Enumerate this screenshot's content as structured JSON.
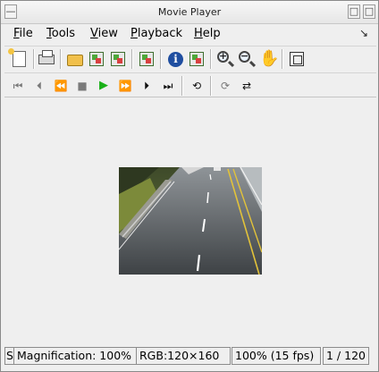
{
  "window": {
    "title": "Movie Player"
  },
  "menubar": {
    "items": [
      {
        "first": "F",
        "rest": "ile"
      },
      {
        "first": "T",
        "rest": "ools"
      },
      {
        "first": "V",
        "rest": "iew"
      },
      {
        "first": "P",
        "rest": "layback"
      },
      {
        "first": "H",
        "rest": "elp"
      }
    ],
    "corner_glyph": "↘"
  },
  "toolbar_main": {
    "icons": [
      "new-document-icon",
      "print-icon",
      "open-folder-icon",
      "file-export-icon",
      "network-export-icon",
      "image-properties-icon",
      "info-icon",
      "color-map-icon",
      "zoom-in-icon",
      "zoom-out-icon",
      "pan-hand-icon",
      "fit-to-window-icon"
    ]
  },
  "toolbar_playback": {
    "icons": [
      "first-frame-icon",
      "step-back-icon",
      "rewind-icon",
      "stop-icon",
      "play-icon",
      "fast-forward-icon",
      "step-forward-icon",
      "last-frame-icon",
      "loop-icon",
      "repeat-icon",
      "swap-direction-icon"
    ],
    "glyphs": {
      "first": "⏮",
      "step_back": "⏴",
      "rewind": "⏪",
      "stop": "■",
      "play": "▶",
      "ffwd": "⏩",
      "step_fwd": "⏵",
      "last": "⏭",
      "loop": "⟲",
      "repeat": "⟳",
      "swap": "⇄"
    }
  },
  "video": {
    "content": "highway-frame"
  },
  "statusbar": {
    "left_fragment": "S",
    "magnification": "Magnification: 100%",
    "rgb": "RGB:120×160",
    "fps": "100% (15 fps)",
    "frame": "1 / 120"
  },
  "colors": {
    "window_bg": "#efefef",
    "play_green": "#19b018",
    "border": "#8a8a8a"
  }
}
